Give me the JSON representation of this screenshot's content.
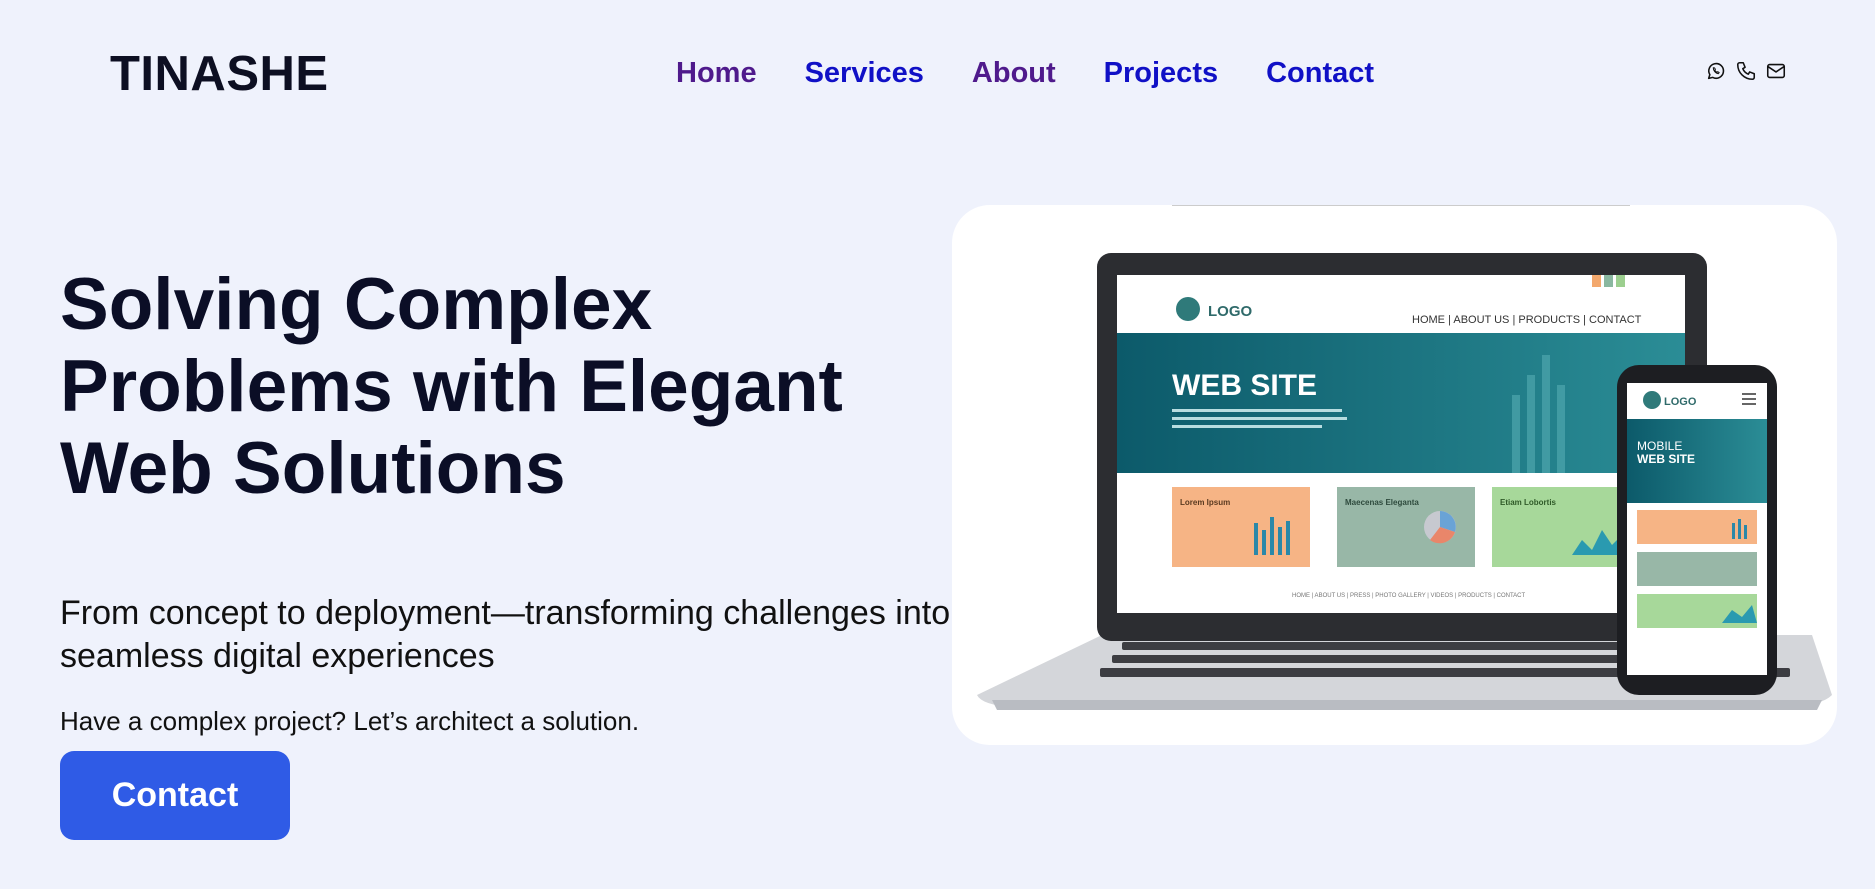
{
  "brand": {
    "name": "TINASHE"
  },
  "nav": {
    "items": [
      {
        "label": "Home",
        "state": "visited"
      },
      {
        "label": "Services",
        "state": "link"
      },
      {
        "label": "About",
        "state": "visited"
      },
      {
        "label": "Projects",
        "state": "link"
      },
      {
        "label": "Contact",
        "state": "link"
      }
    ]
  },
  "contact_icons": [
    "whatsapp-icon",
    "phone-icon",
    "mail-icon"
  ],
  "hero": {
    "title": "Solving Complex Problems with Elegant Web Solutions",
    "subtitle": "From concept to deployment—transforming challenges into seamless digital experiences",
    "cta_text": "Have a complex project? Let’s architect a solution.",
    "cta_button": "Contact"
  },
  "mockup": {
    "logo": "LOGO",
    "nav_text": "HOME | ABOUT US | PRODUCTS | CONTACT",
    "banner": "WEB SITE",
    "mobile_banner_line1": "MOBILE",
    "mobile_banner_line2": "WEB SITE",
    "card1": "Lorem Ipsum",
    "card2": "Maecenas Eleganta",
    "card3": "Etiam Lobortis",
    "footer_text": "HOME | ABOUT US | PRESS | PHOTO GALLERY | VIDEOS | PRODUCTS | CONTACT"
  },
  "colors": {
    "background": "#eff2fc",
    "accent": "#2f5be6",
    "nav_visited": "#4f1a8c",
    "nav_link": "#1010c6"
  }
}
